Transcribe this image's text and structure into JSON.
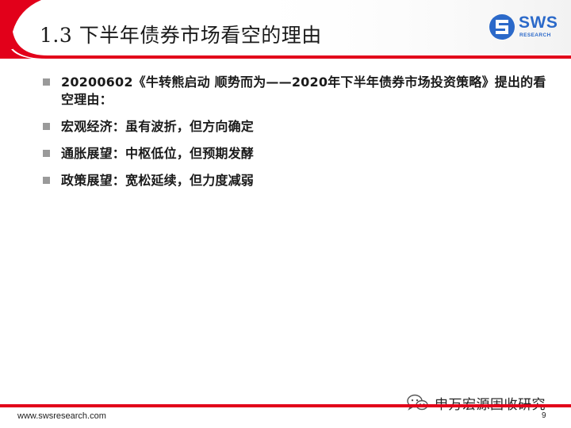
{
  "header": {
    "title": "1.3 下半年债券市场看空的理由",
    "accent_color": "#e2001a",
    "logo": {
      "name": "SWS",
      "subtitle": "RESEARCH",
      "color": "#2b69c9"
    }
  },
  "bullets": [
    {
      "text": "20200602《牛转熊启动  顺势而为——2020年下半年债券市场投资策略》提出的看空理由："
    },
    {
      "text": "宏观经济：虽有波折，但方向确定"
    },
    {
      "text": "通胀展望：中枢低位，但预期发酵"
    },
    {
      "text": "政策展望：宽松延续，但力度减弱"
    }
  ],
  "footer": {
    "url": "www.swsresearch.com",
    "page": "9",
    "watermark": "申万宏源固收研究"
  }
}
